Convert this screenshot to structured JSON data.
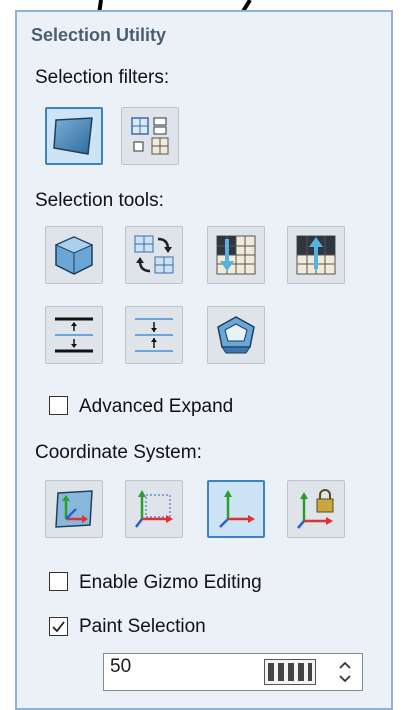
{
  "panel": {
    "title": "Selection Utility"
  },
  "selection_filters": {
    "label": "Selection filters:",
    "buttons": [
      {
        "icon": "face-filter-icon",
        "selected": true
      },
      {
        "icon": "element-filter-icon",
        "selected": false
      }
    ]
  },
  "selection_tools": {
    "label": "Selection tools:",
    "buttons": [
      {
        "icon": "select-body-icon"
      },
      {
        "icon": "swap-selection-icon"
      },
      {
        "icon": "grow-down-icon"
      },
      {
        "icon": "grow-up-icon"
      },
      {
        "icon": "shrink-selection-icon"
      },
      {
        "icon": "expand-selection-icon"
      },
      {
        "icon": "select-boundary-icon"
      }
    ]
  },
  "advanced_expand": {
    "label": "Advanced Expand",
    "checked": false
  },
  "coordinate_system": {
    "label": "Coordinate System:",
    "buttons": [
      {
        "icon": "view-coordinates-icon",
        "selected": false
      },
      {
        "icon": "world-coordinates-icon",
        "selected": false
      },
      {
        "icon": "local-coordinates-icon",
        "selected": true
      },
      {
        "icon": "locked-coordinates-icon",
        "selected": false
      }
    ]
  },
  "enable_gizmo_editing": {
    "label": "Enable Gizmo Editing",
    "checked": false
  },
  "paint_selection": {
    "label": "Paint Selection",
    "checked": true
  },
  "brush_size": {
    "value": "50"
  },
  "colors": {
    "panel_border": "#8cb3d6",
    "accent": "#3c82c4",
    "axis_x": "#e03030",
    "axis_y": "#2aa02a",
    "axis_z": "#2a5fd0"
  }
}
